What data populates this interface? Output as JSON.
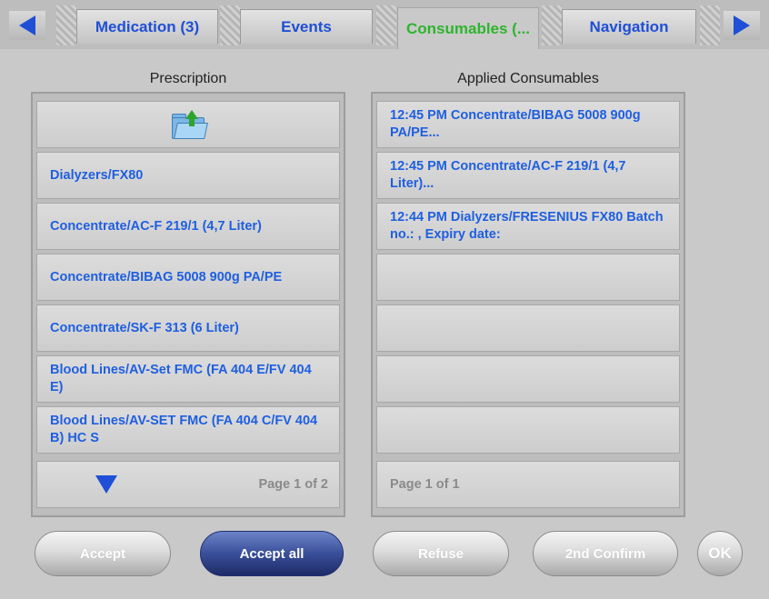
{
  "tabs": [
    {
      "label": "Medication (3)",
      "active": false
    },
    {
      "label": "Events",
      "active": false
    },
    {
      "label": "Consumables (...",
      "active": true
    },
    {
      "label": "Navigation",
      "active": false
    }
  ],
  "prescription": {
    "title": "Prescription",
    "items": [
      "Dialyzers/FX80",
      "Concentrate/AC-F 219/1 (4,7 Liter)",
      "Concentrate/BIBAG 5008 900g PA/PE",
      "Concentrate/SK-F 313 (6 Liter)",
      "Blood Lines/AV-Set FMC (FA 404 E/FV 404 E)",
      "Blood Lines/AV-SET FMC (FA 404 C/FV 404 B) HC S"
    ],
    "page": "Page 1 of 2"
  },
  "applied": {
    "title": "Applied Consumables",
    "items": [
      "12:45 PM Concentrate/BIBAG 5008 900g PA/PE...",
      "12:45 PM Concentrate/AC-F 219/1 (4,7 Liter)...",
      "12:44 PM Dialyzers/FRESENIUS FX80 Batch no.: , Expiry date:"
    ],
    "page": "Page 1 of 1"
  },
  "buttons": {
    "accept": "Accept",
    "accept_all": "Accept all",
    "refuse": "Refuse",
    "second_confirm": "2nd Confirm",
    "ok": "OK"
  },
  "icons": {
    "left": "left-arrow-icon",
    "right": "right-arrow-icon",
    "folder_up": "folder-up-icon",
    "page_down": "page-down-icon"
  },
  "colors": {
    "accent": "#1f5fe0",
    "active_tab": "#2db52d",
    "primary_button": "#3a4f9a"
  }
}
